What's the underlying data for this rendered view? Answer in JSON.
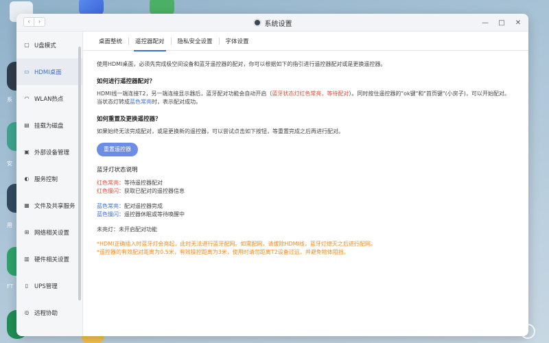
{
  "desktop": {
    "left_labels": [
      "系",
      "安",
      "用",
      "FT"
    ]
  },
  "window": {
    "title": "系统设置",
    "nav_back": "‹",
    "nav_forward": "›",
    "ctrl_min": "—",
    "ctrl_max": "□",
    "ctrl_close": "✕"
  },
  "sidebar": {
    "items": [
      {
        "label": "U盘模式",
        "icon": "usb-icon"
      },
      {
        "label": "HDMI桌面",
        "icon": "monitor-icon"
      },
      {
        "label": "WLAN热点",
        "icon": "wifi-icon"
      },
      {
        "label": "挂载为磁盘",
        "icon": "disk-icon"
      },
      {
        "label": "外部设备管理",
        "icon": "device-icon"
      },
      {
        "label": "服务控制",
        "icon": "toggle-icon"
      },
      {
        "label": "文件及共享服务",
        "icon": "folder-icon"
      },
      {
        "label": "网络相关设置",
        "icon": "network-icon"
      },
      {
        "label": "硬件相关设置",
        "icon": "hardware-icon"
      },
      {
        "label": "UPS管理",
        "icon": "ups-icon"
      },
      {
        "label": "远程协助",
        "icon": "remote-icon"
      }
    ]
  },
  "tabs": [
    "桌面整统",
    "遥控器配对",
    "隐私安全设置",
    "字体设置"
  ],
  "content": {
    "intro": "使用HDMI桌面，必须先完成极空间设备和蓝牙遥控器的配对，你可以根据如下的指引进行遥控器配对或是更换遥控器。",
    "pair_heading": "如何进行遥控器配对？",
    "pair_text_1": "HDMI线一端连接T2，另一端连接显示器后，蓝牙配对功能会自动开启（",
    "pair_text_red": "蓝牙状态灯红色常亮，等待配对",
    "pair_text_2": "）。同时按住遥控器的\"ok键\"和\"首页键\"(小房子)，可以开始配对。当状态灯转成",
    "pair_text_blue": "蓝色常亮",
    "pair_text_3": "时，表示配对成功。",
    "reset_heading": "如何重置及更换遥控器？",
    "reset_text": "如果始终无法完成配对，或是更换新的遥控器，可以尝试点击如下按钮，等重置完成之后再进行配对。",
    "reset_button": "重置遥控器",
    "status_heading": "蓝牙灯状态说明",
    "status_red": [
      {
        "label": "红色常亮：",
        "desc": "等待遥控器配对"
      },
      {
        "label": "红色慢闪：",
        "desc": "获取已配对的遥控器信息"
      }
    ],
    "status_blue": [
      {
        "label": "蓝色常亮：",
        "desc": "配对遥控器完成"
      },
      {
        "label": "蓝色慢闪：",
        "desc": "遥控器休眠或等待唤醒中"
      }
    ],
    "status_off": {
      "label": "未亮灯：",
      "desc": "未开启配对功能"
    },
    "note_1": "*HDMI正确插入时蓝牙灯会亮起，此时无法进行蓝牙配网。如需配网，请拔除HDMI线，蓝牙灯熄灭之后进行配网。",
    "note_2": "*遥控器的有效配对距离为0.5米，有效操控距离为3米，使用时请勿距离T2设备过远，并避免物体阻挡。"
  },
  "colors": {
    "accent": "#3a6fd8",
    "red": "#e04a3a",
    "orange": "#f08a1e",
    "button": "#6b8de6"
  }
}
